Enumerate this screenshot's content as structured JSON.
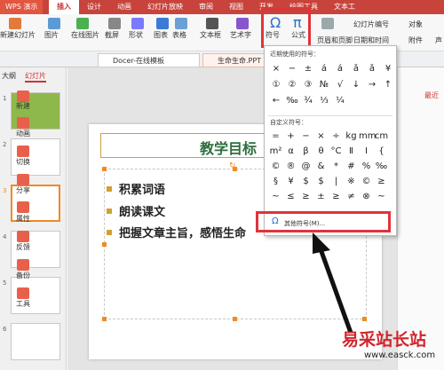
{
  "app": {
    "title": "WPS 演示"
  },
  "tabs": [
    "插入",
    "设计",
    "动画",
    "幻灯片放映",
    "审阅",
    "视图",
    "开发",
    "绘图工具",
    "文本工"
  ],
  "ribbon": {
    "buttons": [
      "新建幻灯片",
      "图片",
      "在线图片",
      "截屏",
      "形状",
      "图表",
      "表格",
      "文本框",
      "艺术字",
      "符号",
      "公式",
      "页眉和页脚",
      "幻灯片编号",
      "日期和时间",
      "对象",
      "附件",
      "声"
    ]
  },
  "doc_tabs": [
    "Docer-在线模板",
    "生命生命.PPT"
  ],
  "sidebar": {
    "tabs": [
      "大纲",
      "幻灯片"
    ],
    "slide_numbers": [
      "1",
      "2",
      "3",
      "4",
      "5",
      "6"
    ]
  },
  "slide": {
    "title": "教学目标",
    "bullets": [
      "积累词语",
      "朗读课文",
      "把握文章主旨，感悟生命"
    ]
  },
  "symbol_menu": {
    "recent_label": "近期使用的符号：",
    "recent": [
      "×",
      "−",
      "±",
      "á",
      "á",
      "ǎ",
      "ǎ",
      "¥",
      "①",
      "②",
      "③",
      "№",
      "√",
      "↓",
      "→",
      "↑",
      "←",
      "‰",
      "¾",
      "⅓",
      "¼"
    ],
    "custom_label": "自定义符号：",
    "custom": [
      "=",
      "+",
      "−",
      "×",
      "÷",
      "kg",
      "mm",
      "cm",
      "m²",
      "α",
      "β",
      "θ",
      "°C",
      "Ⅱ",
      "Ⅰ",
      "{",
      "©",
      "®",
      "@",
      "&",
      "*",
      "#",
      "%",
      "‰",
      "§",
      "¥",
      "$",
      "$",
      "|",
      "※",
      "©",
      "≥",
      "~",
      "≤",
      "≥",
      "±",
      "≥",
      "≠",
      "⊗",
      "~"
    ],
    "more_label": "其他符号(M)..."
  },
  "rightpanel": [
    "新建",
    "动画",
    "切换",
    "分享",
    "属性",
    "反馈",
    "备份",
    "工具"
  ],
  "rightpanel_extra": "最近",
  "watermark": {
    "text": "易采站长站",
    "url": "www.easck.com"
  },
  "colors": {
    "accent": "#e0333a",
    "titlebar": "#c8433b"
  }
}
